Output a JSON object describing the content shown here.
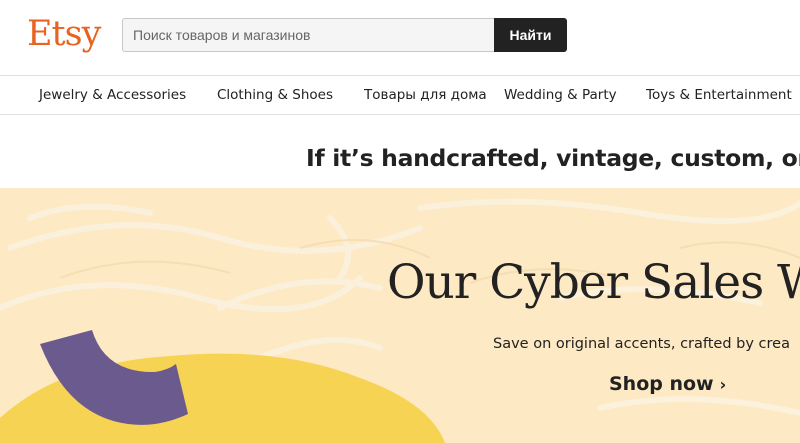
{
  "header": {
    "logo_text": "Etsy",
    "search": {
      "placeholder": "Поиск товаров и магазинов",
      "button_label": "Найти"
    }
  },
  "nav": {
    "items": [
      {
        "label": "Jewelry & Accessories"
      },
      {
        "label": "Clothing & Shoes"
      },
      {
        "label": "Товары для дома"
      },
      {
        "label": "Wedding & Party"
      },
      {
        "label": "Toys & Entertainment"
      }
    ]
  },
  "tagline": "If it’s handcrafted, vintage, custom, or u",
  "hero": {
    "title": "Our Cyber Sales We",
    "subtitle": "Save on original accents, crafted by crea",
    "cta_label": "Shop now",
    "cta_icon": "chevron-right-icon",
    "colors": {
      "background": "#fde9c4",
      "yellow_shape": "#f7d354",
      "purple_shape": "#6b5a8e"
    }
  },
  "colors": {
    "brand": "#e8631f",
    "button": "#222222"
  }
}
